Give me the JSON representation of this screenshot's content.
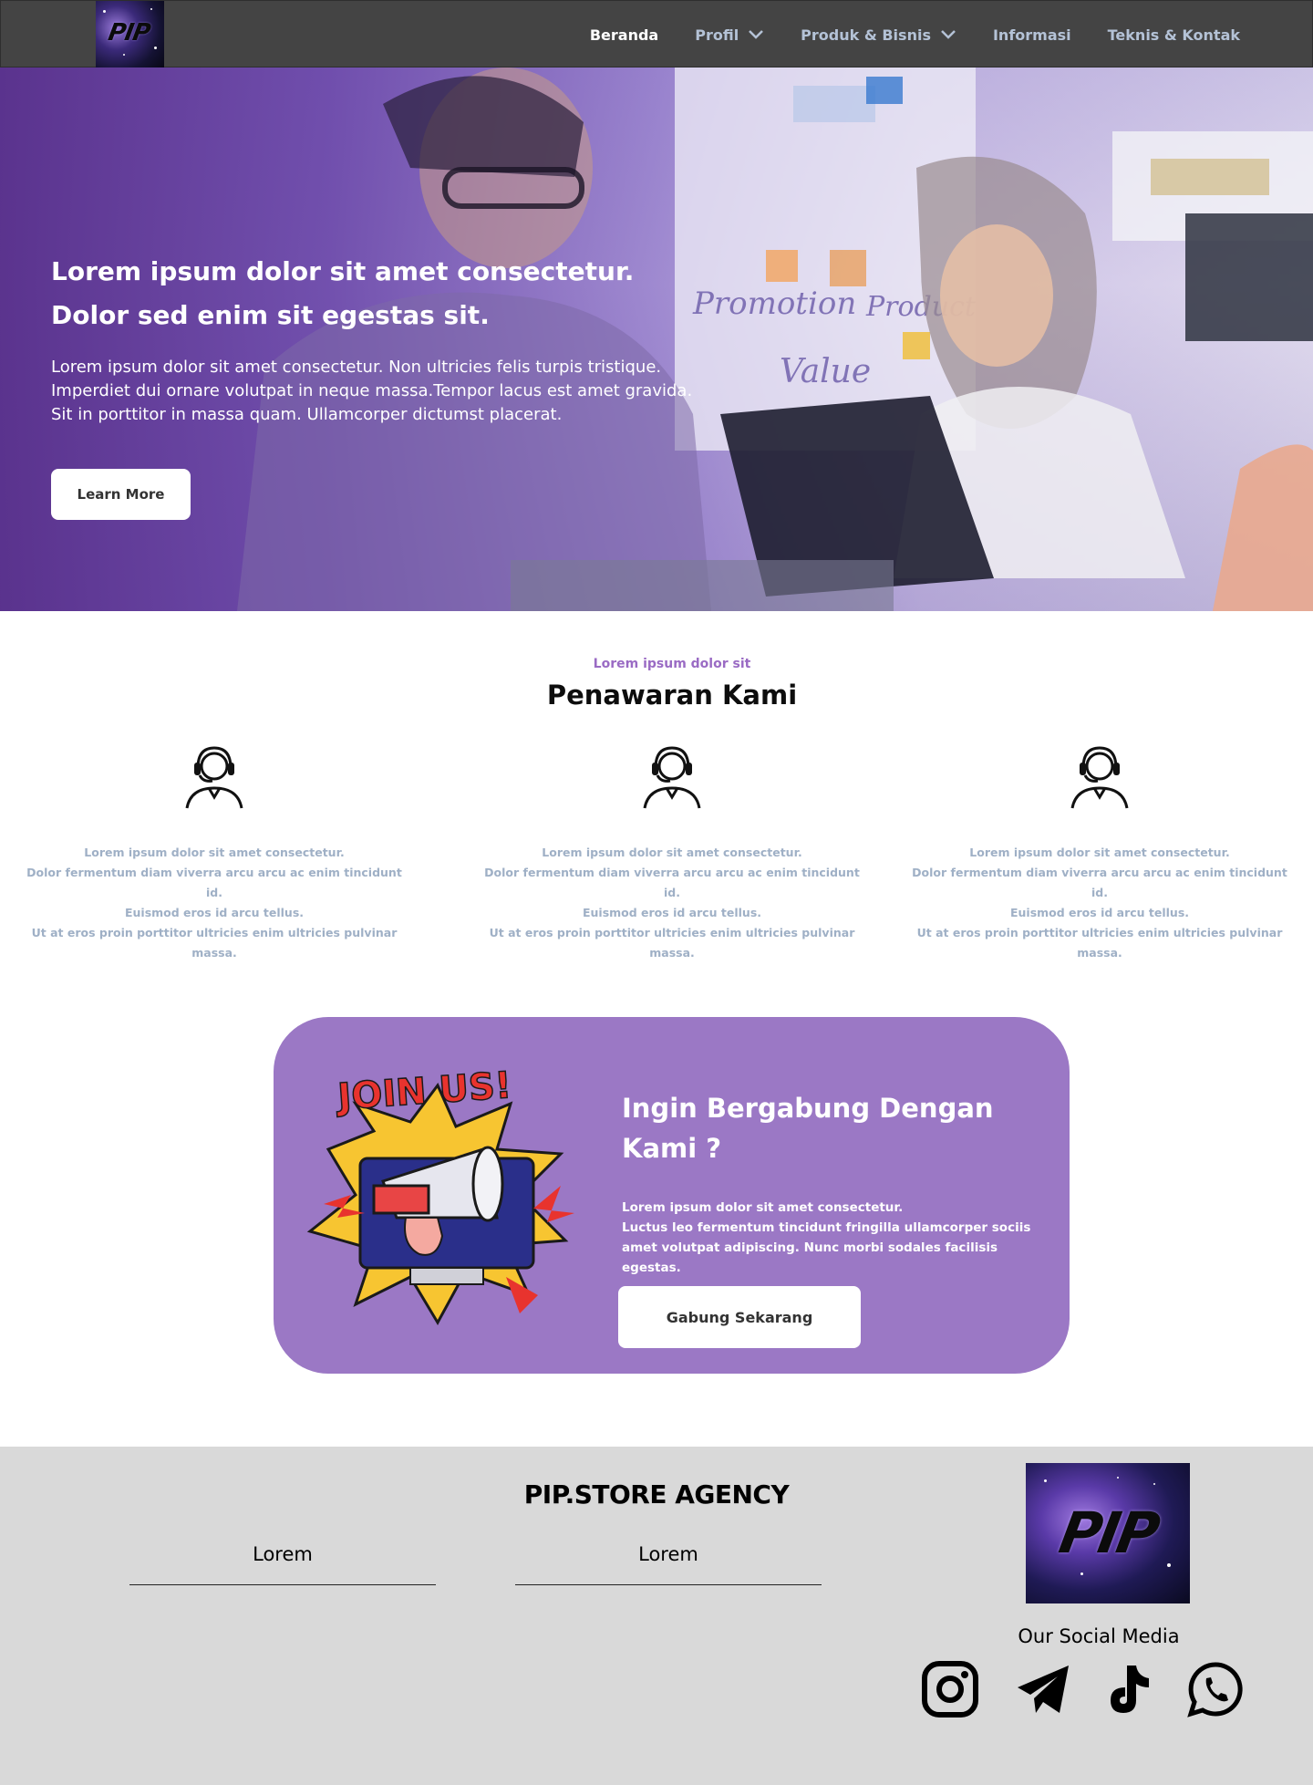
{
  "nav": {
    "logo_text": "PIP",
    "items": [
      {
        "label": "Beranda",
        "active": true,
        "dropdown": false
      },
      {
        "label": "Profil",
        "active": false,
        "dropdown": true
      },
      {
        "label": "Produk & Bisnis",
        "active": false,
        "dropdown": true
      },
      {
        "label": "Informasi",
        "active": false,
        "dropdown": false
      },
      {
        "label": "Teknis & Kontak",
        "active": false,
        "dropdown": false
      }
    ]
  },
  "hero": {
    "title_line1": "Lorem ipsum dolor sit amet consectetur.",
    "title_line2": "Dolor sed enim sit egestas sit.",
    "desc_line1": "Lorem ipsum dolor sit amet consectetur. Non ultricies felis turpis tristique.",
    "desc_line2": "Imperdiet dui ornare volutpat in neque massa.Tempor lacus est amet gravida.",
    "desc_line3": "Sit in porttitor in massa quam. Ullamcorper dictumst placerat.",
    "whiteboard_words": [
      "Promotion",
      "Product",
      "Value"
    ],
    "button_label": "Learn More"
  },
  "offer": {
    "kicker": "Lorem ipsum dolor sit",
    "title": "Penawaran Kami",
    "items": [
      {
        "icon": "customer-support-icon",
        "text": "Lorem ipsum dolor sit amet consectetur.\nDolor fermentum diam viverra arcu arcu ac enim tincidunt id.\nEuismod eros id arcu tellus.\nUt at eros proin porttitor ultricies enim ultricies pulvinar massa."
      },
      {
        "icon": "customer-support-icon",
        "text": "Lorem ipsum dolor sit amet consectetur.\nDolor fermentum diam viverra arcu arcu ac enim tincidunt id.\nEuismod eros id arcu tellus.\nUt at eros proin porttitor ultricies enim ultricies pulvinar massa."
      },
      {
        "icon": "customer-support-icon",
        "text": "Lorem ipsum dolor sit amet consectetur.\nDolor fermentum diam viverra arcu arcu ac enim tincidunt id.\nEuismod eros id arcu tellus.\nUt at eros proin porttitor ultricies enim ultricies pulvinar massa."
      }
    ]
  },
  "join": {
    "illustration_text": "JOIN US!",
    "title_line1": "Ingin Bergabung Dengan",
    "title_line2": "Kami ?",
    "desc": "Lorem ipsum dolor sit amet consectetur.\n Luctus leo fermentum tincidunt fringilla ullamcorper sociis\n amet volutpat adipiscing. Nunc morbi sodales facilisis egestas.",
    "button_label": "Gabung Sekarang",
    "card_color": "#9b78c5"
  },
  "footer": {
    "brand": "PIP.STORE AGENCY",
    "col1_label": "Lorem",
    "col2_label": "Lorem",
    "logo_text": "PIP",
    "social_label": "Our Social Media",
    "social_icons": [
      "instagram-icon",
      "telegram-icon",
      "tiktok-icon",
      "whatsapp-icon"
    ]
  },
  "colors": {
    "nav_bg": "#444444",
    "accent_purple": "#9b78c5",
    "kicker_purple": "#9a6bc4",
    "muted_text": "#9fb0c6",
    "footer_bg": "#d9d9d9"
  }
}
